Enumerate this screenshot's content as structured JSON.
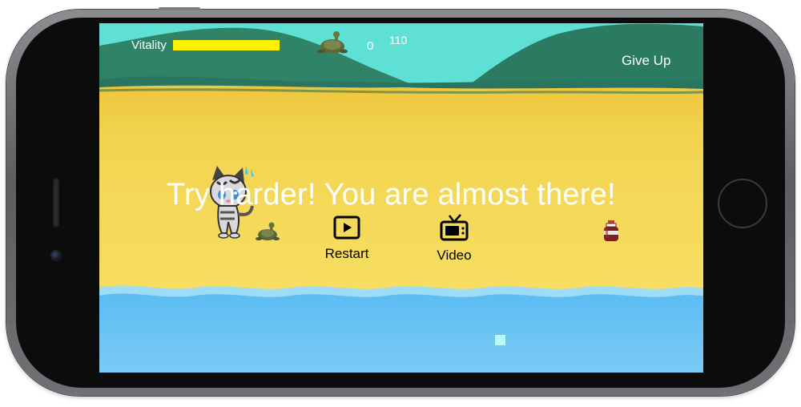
{
  "hud": {
    "vitality_label": "Vitality",
    "vitality_level": 0.55,
    "counter": "0",
    "score": "110"
  },
  "controls": {
    "give_up": "Give Up",
    "restart_label": "Restart",
    "video_label": "Video"
  },
  "message": "Try harder! You are almost there!",
  "icons": {
    "restart": "play-box-icon",
    "video": "tv-icon",
    "enemy": "turtle-icon",
    "player": "cat-icon",
    "item": "potion-icon"
  },
  "colors": {
    "sky": "#5fe0d4",
    "hills": "#2e7f66",
    "sand": "#f4d957",
    "water": "#6cc3f5",
    "vitality": "#fff200"
  }
}
